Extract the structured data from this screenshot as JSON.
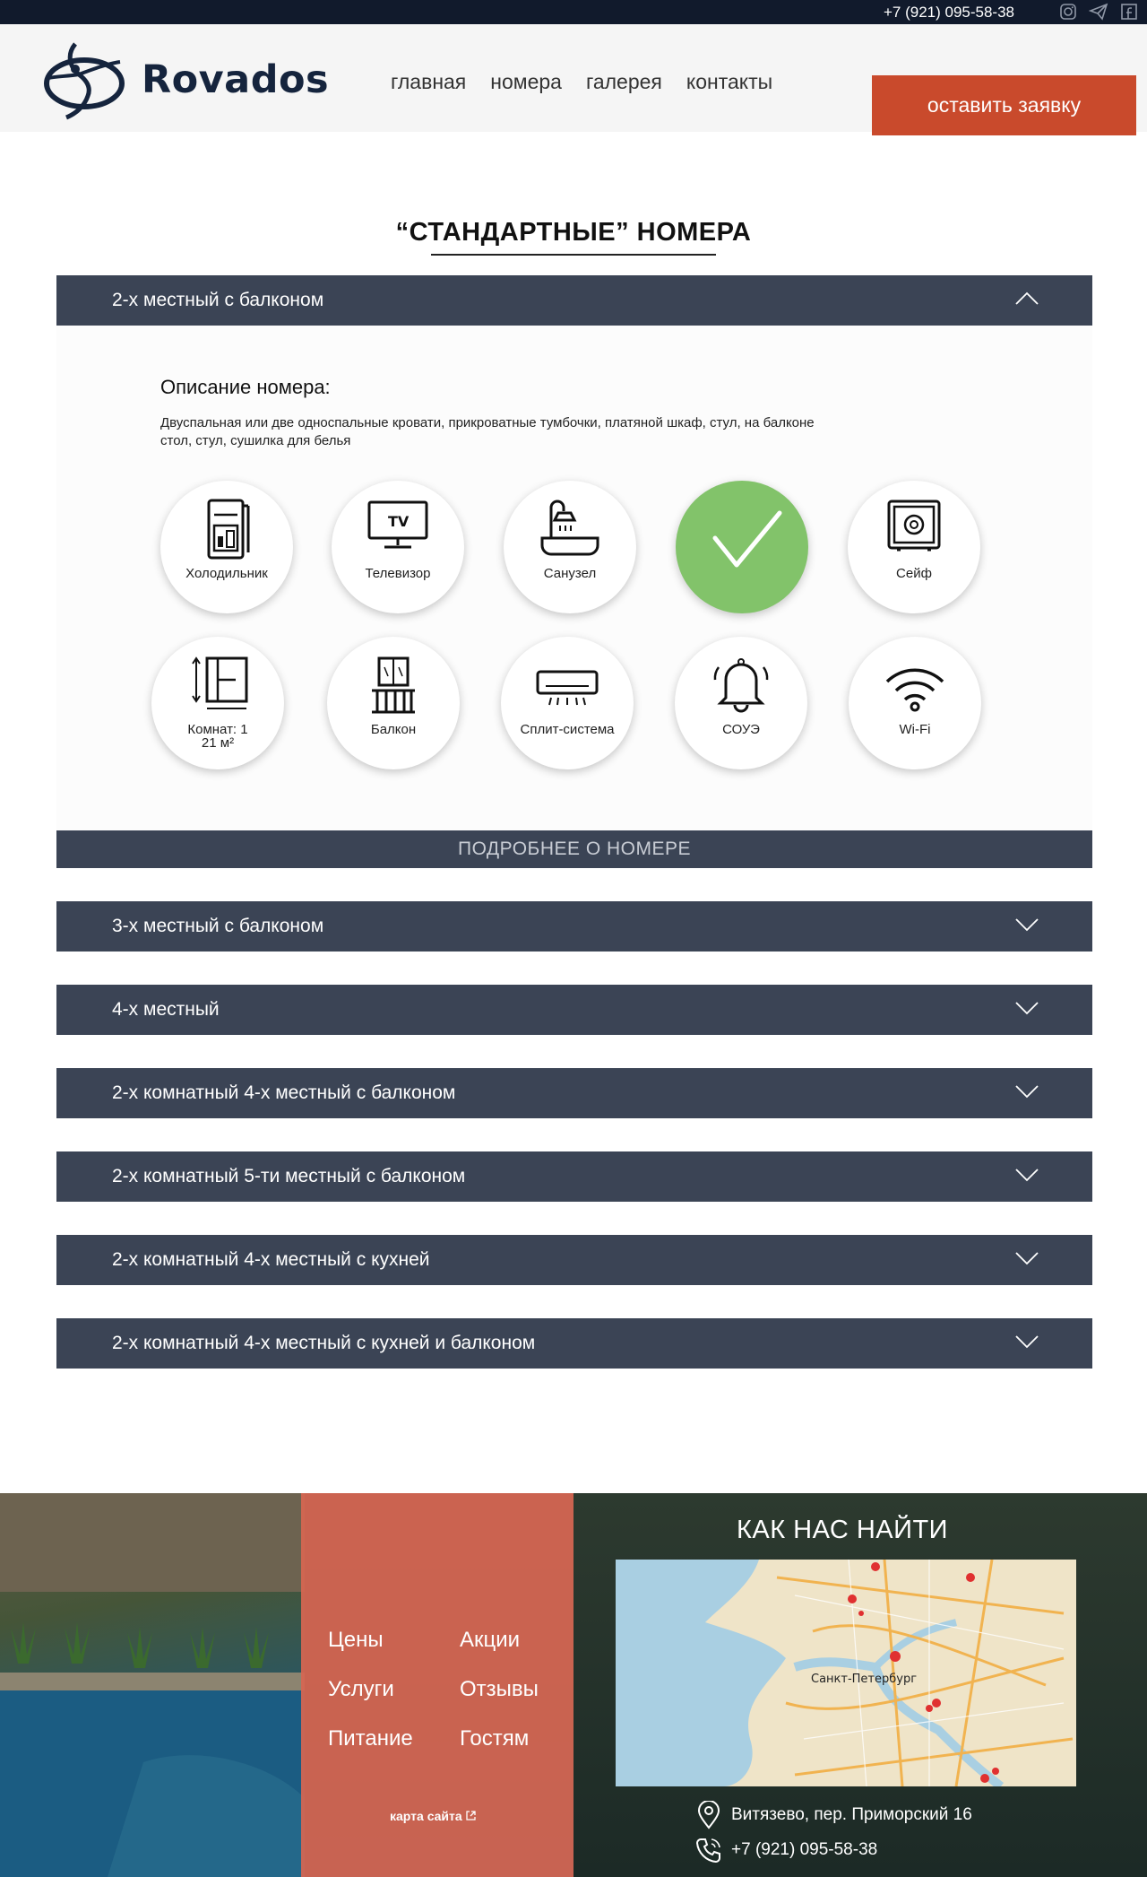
{
  "topbar": {
    "phone": "+7 (921) 095-58-38",
    "social_icons": [
      "instagram-icon",
      "telegram-icon",
      "facebook-icon"
    ]
  },
  "header": {
    "brand": "Rovados",
    "nav": [
      "главная",
      "номера",
      "галерея",
      "контакты"
    ],
    "cta": "оставить заявку"
  },
  "section": {
    "title": "“СТАНДАРТНЫЕ” НОМЕРА"
  },
  "open_room": {
    "title": "2-х местный с балконом",
    "desc_title": "Описание номера:",
    "desc_text": "Двуспальная или две односпальные кровати, прикроватные тумбочки, платяной шкаф, стул, на балконе стол, стул, сушилка для белья",
    "features_row1": [
      "Холодильник",
      "Телевизор",
      "Санузел",
      "",
      "Сейф"
    ],
    "features_row2": [
      "Комнат: 1",
      "Балкон",
      "Сплит-система",
      "СОУЭ",
      "Wi-Fi"
    ],
    "area_text": "21 м²",
    "highlighted_feature_icon": "checkmark-icon",
    "more_button": "ПОДРОБНЕЕ О НОМЕРЕ"
  },
  "rooms": [
    "3-х местный с балконом",
    "4-х местный",
    "2-х комнатный 4-х местный с балконом",
    "2-х комнатный 5-ти местный с балконом",
    "2-х комнатный 4-х местный с кухней",
    "2-х комнатный 4-х местный с кухней и балконом"
  ],
  "footer": {
    "menu": [
      "Цены",
      "Акции",
      "Услуги",
      "Отзывы",
      "Питание",
      "Гостям"
    ],
    "sitemap": "карта сайта",
    "find_title": "КАК НАС НАЙТИ",
    "map_label": "Санкт-Петербург",
    "address": "Витязево, пер. Приморский 16",
    "phone": "+7 (921) 095-58-38"
  },
  "colors": {
    "dark_nav": "#111a2c",
    "accordion": "#3b4455",
    "accent": "#c94a2c",
    "green": "#82c36a",
    "menu_box": "#d66652"
  }
}
